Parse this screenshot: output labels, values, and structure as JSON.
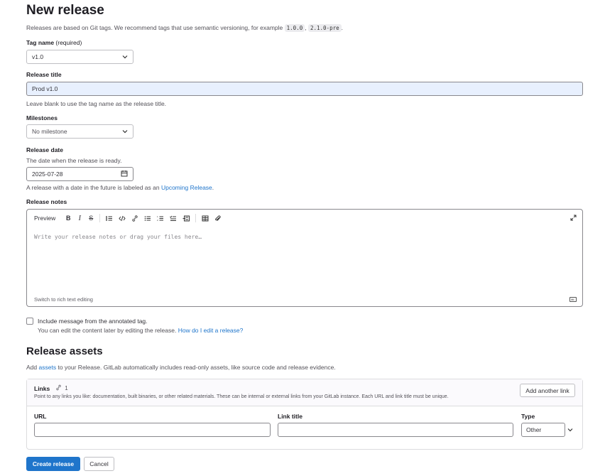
{
  "page": {
    "title": "New release",
    "intro_text": "Releases are based on Git tags. We recommend tags that use semantic versioning, for example",
    "intro_code1": "1.0.0",
    "intro_sep": ",",
    "intro_code2": "2.1.0-pre",
    "intro_end": "."
  },
  "tag": {
    "label": "Tag name",
    "required": "(required)",
    "value": "v1.0"
  },
  "release_title": {
    "label": "Release title",
    "value": "Prod v1.0",
    "help": "Leave blank to use the tag name as the release title."
  },
  "milestones": {
    "label": "Milestones",
    "value": "No milestone"
  },
  "release_date": {
    "label": "Release date",
    "help_top": "The date when the release is ready.",
    "value": "2025-07-28",
    "help_bottom_prefix": "A release with a date in the future is labeled as an",
    "help_bottom_link": "Upcoming Release",
    "help_bottom_suffix": "."
  },
  "notes": {
    "label": "Release notes",
    "preview": "Preview",
    "placeholder": "Write your release notes or drag your files here…",
    "switch_text": "Switch to rich text editing"
  },
  "annotated": {
    "label": "Include message from the annotated tag.",
    "help_prefix": "You can edit the content later by editing the release.",
    "help_link": "How do I edit a release?"
  },
  "assets": {
    "heading": "Release assets",
    "desc_prefix": "Add",
    "desc_link": "assets",
    "desc_suffix": "to your Release. GitLab automatically includes read-only assets, like source code and release evidence."
  },
  "links": {
    "title": "Links",
    "count": "1",
    "desc": "Point to any links you like: documentation, built binaries, or other related materials. These can be internal or external links from your GitLab instance. Each URL and link title must be unique.",
    "add_button": "Add another link",
    "col_url": "URL",
    "col_title": "Link title",
    "col_type": "Type",
    "type_value": "Other"
  },
  "actions": {
    "create": "Create release",
    "cancel": "Cancel"
  }
}
